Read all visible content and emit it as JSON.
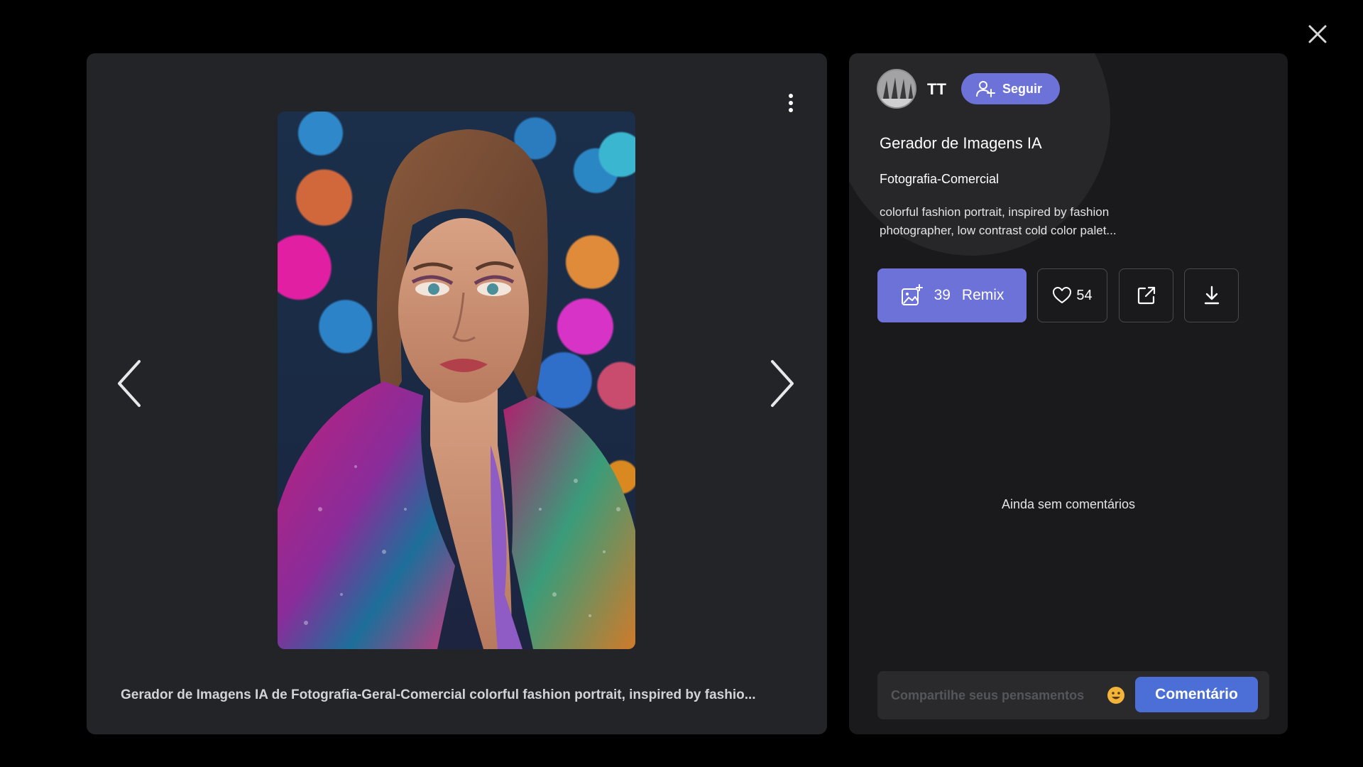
{
  "viewer": {
    "caption": "Gerador de Imagens IA de Fotografia-Geral-Comercial colorful fashion portrait, inspired by fashio..."
  },
  "author": {
    "name": "TT",
    "follow_label": "Seguir"
  },
  "post": {
    "title": "Gerador de Imagens IA",
    "category": "Fotografia-Comercial",
    "description": "colorful fashion portrait, inspired by fashion photographer, low contrast cold color palet..."
  },
  "actions": {
    "remix_count": "39",
    "remix_label": "Remix",
    "like_count": "54"
  },
  "comments": {
    "empty_text": "Ainda sem comentários",
    "input_placeholder": "Compartilhe seus pensamentos",
    "submit_label": "Comentário"
  },
  "icons": {
    "close": "close-icon",
    "more": "more-vertical-icon",
    "prev": "chevron-left-icon",
    "next": "chevron-right-icon",
    "follow": "user-add-icon",
    "remix": "image-sparkle-icon",
    "like": "heart-icon",
    "share": "external-link-icon",
    "download": "download-icon",
    "emoji": "emoji-icon"
  },
  "colors": {
    "accent": "#6d72d9",
    "comment_button": "#4b6fd6",
    "panel_left": "#232427",
    "panel_right": "#1a1a1c"
  }
}
